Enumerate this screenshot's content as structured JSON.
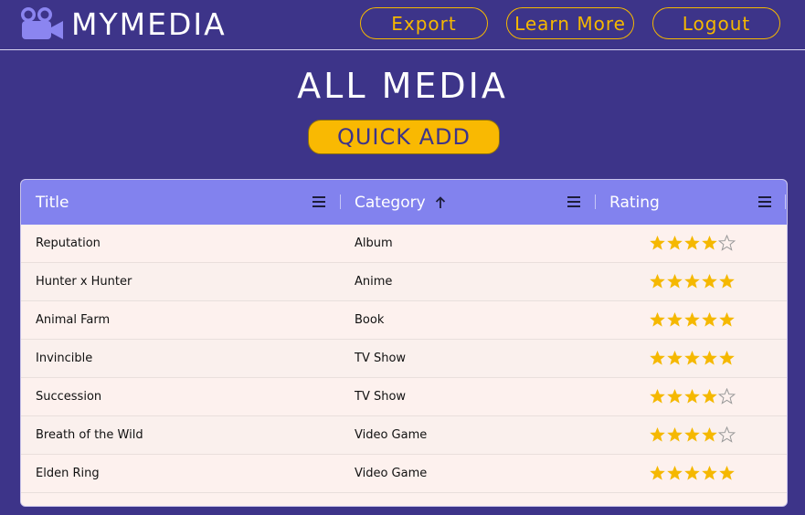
{
  "header": {
    "brand": "MYMEDIA",
    "logo_icon": "movie-camera-icon",
    "buttons": [
      {
        "label": "Export"
      },
      {
        "label": "Learn More"
      },
      {
        "label": "Logout"
      }
    ]
  },
  "main": {
    "title": "ALL MEDIA",
    "quick_add_label": "QUICK ADD"
  },
  "grid": {
    "columns": [
      {
        "label": "Title",
        "sort": null
      },
      {
        "label": "Category",
        "sort": "ascending"
      },
      {
        "label": "Rating",
        "sort": null
      }
    ],
    "max_rating": 5,
    "rows": [
      {
        "title": "Reputation",
        "category": "Album",
        "rating": 4
      },
      {
        "title": "Hunter x Hunter",
        "category": "Anime",
        "rating": 5
      },
      {
        "title": "Animal Farm",
        "category": "Book",
        "rating": 5
      },
      {
        "title": "Invincible",
        "category": "TV Show",
        "rating": 5
      },
      {
        "title": "Succession",
        "category": "TV Show",
        "rating": 4
      },
      {
        "title": "Breath of the Wild",
        "category": "Video Game",
        "rating": 4
      },
      {
        "title": "Elden Ring",
        "category": "Video Game",
        "rating": 5
      }
    ]
  },
  "colors": {
    "background": "#3d3489",
    "accent": "#f5b800",
    "header_row": "#8282ee",
    "star_filled": "#f5b800",
    "star_empty": "#9a9a9a"
  }
}
